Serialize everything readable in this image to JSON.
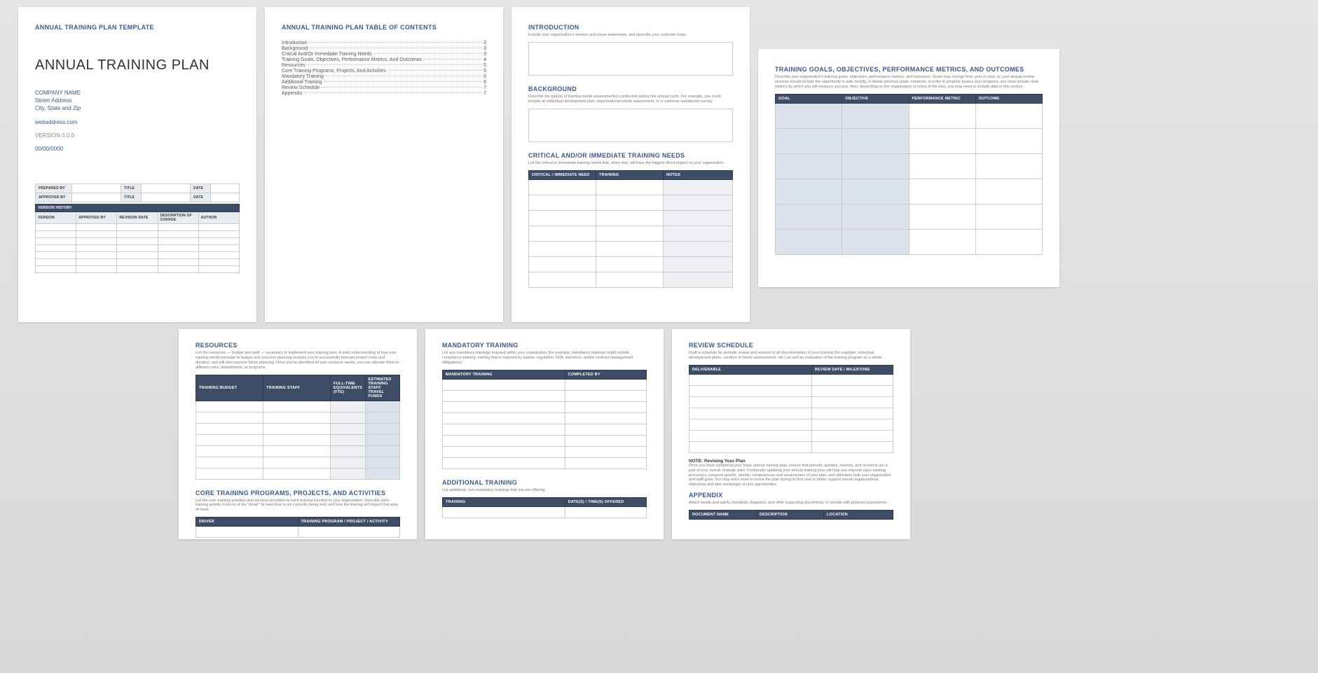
{
  "page1": {
    "header": "ANNUAL TRAINING PLAN TEMPLATE",
    "title": "ANNUAL TRAINING PLAN",
    "company": "COMPANY NAME",
    "street": "Street Address",
    "city": "City, State and Zip",
    "web": "webaddress.com",
    "version": "VERSION 0.0.0",
    "date": "00/00/0000",
    "sig": {
      "prepared": "PREPARED BY",
      "approved": "APPROVED BY",
      "title": "TITLE",
      "dateh": "DATE"
    },
    "vh_title": "VERSION HISTORY",
    "vh_cols": {
      "version": "VERSION",
      "approved": "APPROVED BY",
      "revdate": "REVISION DATE",
      "desc": "DESCRIPTION OF CHANGE",
      "author": "AUTHOR"
    }
  },
  "page2": {
    "header": "ANNUAL TRAINING PLAN TABLE OF CONTENTS",
    "items": [
      {
        "t": "Introduction",
        "p": "3"
      },
      {
        "t": "Background",
        "p": "3"
      },
      {
        "t": "Critical And/Or Immediate Training Needs",
        "p": "3"
      },
      {
        "t": "Training Goals, Objectives, Performance Metrics, And Outcomes",
        "p": "4"
      },
      {
        "t": "Resources",
        "p": "5"
      },
      {
        "t": "Core Training Programs, Projects, And Activities",
        "p": "5"
      },
      {
        "t": "Mandatory Training",
        "p": "6"
      },
      {
        "t": "Additional Training",
        "p": "6"
      },
      {
        "t": "Review Schedule",
        "p": "7"
      },
      {
        "t": "Appendix",
        "p": "7"
      }
    ]
  },
  "page3": {
    "intro_h": "INTRODUCTION",
    "intro_d": "Include your organization's mission and vision statements, and describe your customer base.",
    "bg_h": "BACKGROUND",
    "bg_d": "Describe the type(s) of training needs assessment(s) conducted during this annual cycle. For example, you could include an individual development plan, organizational needs assessment, or a customer satisfaction survey.",
    "crit_h": "CRITICAL AND/OR IMMEDIATE TRAINING NEEDS",
    "crit_d": "List the critical or immediate training needs that, when met, will have the biggest direct impact on your organization.",
    "crit_cols": {
      "need": "CRITICAL / IMMEDIATE NEED",
      "training": "TRAINING",
      "notes": "NOTES"
    }
  },
  "page4": {
    "h": "TRAINING GOALS, OBJECTIVES, PERFORMANCE METRICS, AND OUTCOMES",
    "d": "Describe your organization's training goals, objectives, performance metrics, and outcomes. Goals may change from year to year, so your annual review process should include the opportunity to add, modify, or delete previous goals. However, in order to properly assess your progress, you must include clear metrics by which you will measure success. Also, depending on the organization or intent of the plan, you may need to include data in this section.",
    "cols": {
      "goal": "GOAL",
      "obj": "OBJECTIVE",
      "metric": "PERFORMANCE METRIC",
      "outcome": "OUTCOME"
    }
  },
  "page5": {
    "res_h": "RESOURCES",
    "res_d": "List the resources — budget and staff — necessary to implement your training plan. A solid understanding of how your training needs translate to budget and resource planning enables you to successfully forecast project costs and duration, and will also improve future planning. Once you've identified all your resource needs, you can allocate them to different roles, departments, or programs.",
    "res_cols": {
      "budget": "TRAINING BUDGET",
      "staff": "TRAINING STAFF",
      "fte": "FULL-TIME EQUIVALENTS (FTE)",
      "travel": "ESTIMATED TRAINING STAFF TRAVEL FUNDS"
    },
    "core_h": "CORE TRAINING PROGRAMS, PROJECTS, AND ACTIVITIES",
    "core_d": "List the core training activities and services provided by each training function to your organization. Describe each training activity in terms of the \"driver\" (a need that is not currently being met) and how the training will impact that area of need.",
    "core_cols": {
      "driver": "DRIVER",
      "program": "TRAINING PROGRAM / PROJECT / ACTIVITY"
    }
  },
  "page6": {
    "mand_h": "MANDATORY TRAINING",
    "mand_d": "List any mandatory trainings required within your organization (for example, mandatory trainings might include compliance training, training that is required by statute, regulation, DOE directives, and/or contract management obligations).",
    "mand_cols": {
      "mt": "MANDATORY TRAINING",
      "cb": "COMPLETED BY"
    },
    "add_h": "ADDITIONAL TRAINING",
    "add_d": "List additional, non-mandatory trainings that you are offering.",
    "add_cols": {
      "t": "TRAINING",
      "dt": "DATE(S) / TIME(S) OFFERED"
    }
  },
  "page7": {
    "rev_h": "REVIEW SCHEDULE",
    "rev_d": "Draft a schedule for periodic review and revision of all documentation of your training (for example, individual development plans, conduct of needs assessments, etc.) as well as evaluation of the training program as a whole.",
    "rev_cols": {
      "del": "DELIVERABLE",
      "rdm": "REVIEW DATE / MILESTONE"
    },
    "note_t": "NOTE: Revising Your Plan",
    "note_d": "Once you have completed your basic annual training plan, ensure that periodic updates, reviews, and revisions are a part of your overall strategic plan. Continually updating your annual training plan will help you improve upon existing processes, measure growth, identify competencies and weaknesses of your plan, and ultimately help your organization and staff grow. You may even need to revise the plan during its first year to better support overall organizational objectives and take advantage of new opportunities.",
    "app_h": "APPENDIX",
    "app_d": "Attach health and safety checklists, diagrams, and other supporting documents, or include with pertinent procedures.",
    "app_cols": {
      "dn": "DOCUMENT NAME",
      "de": "DESCRIPTION",
      "lo": "LOCATION"
    }
  }
}
